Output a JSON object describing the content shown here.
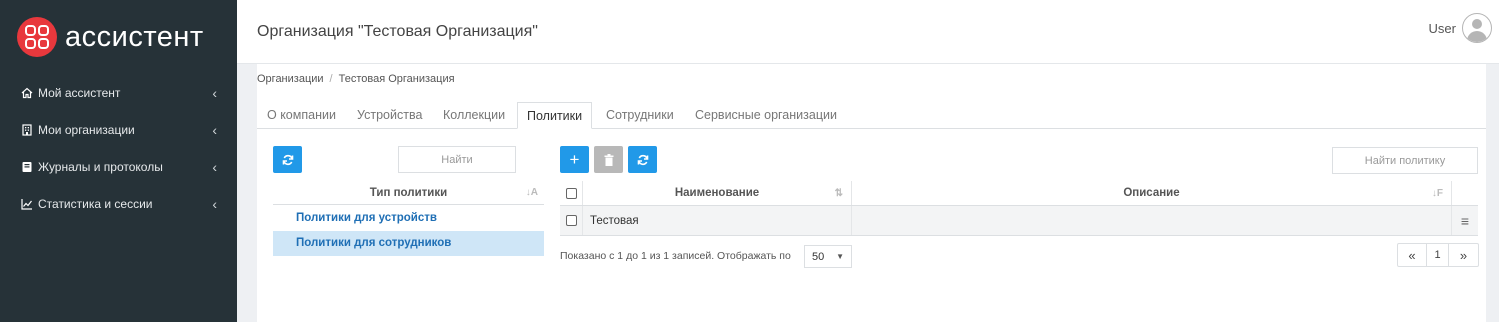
{
  "sidebar": {
    "logo_text": "ассистент",
    "items": [
      {
        "label": "Мой ассистент",
        "icon": "home-icon"
      },
      {
        "label": "Мои организации",
        "icon": "building-icon"
      },
      {
        "label": "Журналы и протоколы",
        "icon": "book-icon"
      },
      {
        "label": "Статистика и сессии",
        "icon": "chart-icon"
      }
    ]
  },
  "header": {
    "title": "Организация \"Тестовая Организация\"",
    "user": "User"
  },
  "breadcrumb": {
    "root": "Организации",
    "separator": "/",
    "current": "Тестовая Организация"
  },
  "tabs": [
    {
      "label": "О компании"
    },
    {
      "label": "Устройства"
    },
    {
      "label": "Коллекции"
    },
    {
      "label": "Политики",
      "active": true
    },
    {
      "label": "Сотрудники"
    },
    {
      "label": "Сервисные организации"
    }
  ],
  "policy_types": {
    "search_placeholder": "Найти",
    "column_header": "Тип политики",
    "rows": [
      {
        "label": "Политики для устройств",
        "selected": false
      },
      {
        "label": "Политики для сотрудников",
        "selected": true
      }
    ]
  },
  "policies": {
    "search_placeholder": "Найти политику",
    "columns": {
      "name": "Наименование",
      "description": "Описание"
    },
    "rows": [
      {
        "name": "Тестовая",
        "description": ""
      }
    ],
    "footer_text": "Показано с 1 до 1 из 1 записей. Отображать по",
    "page_size": "50",
    "pager": {
      "prev": "«",
      "current": "1",
      "next": "»"
    }
  },
  "colors": {
    "sidebar_bg": "#263238",
    "accent_blue": "#2199e8",
    "logo_red": "#e8383d",
    "selected_row": "#cfe6f7"
  }
}
